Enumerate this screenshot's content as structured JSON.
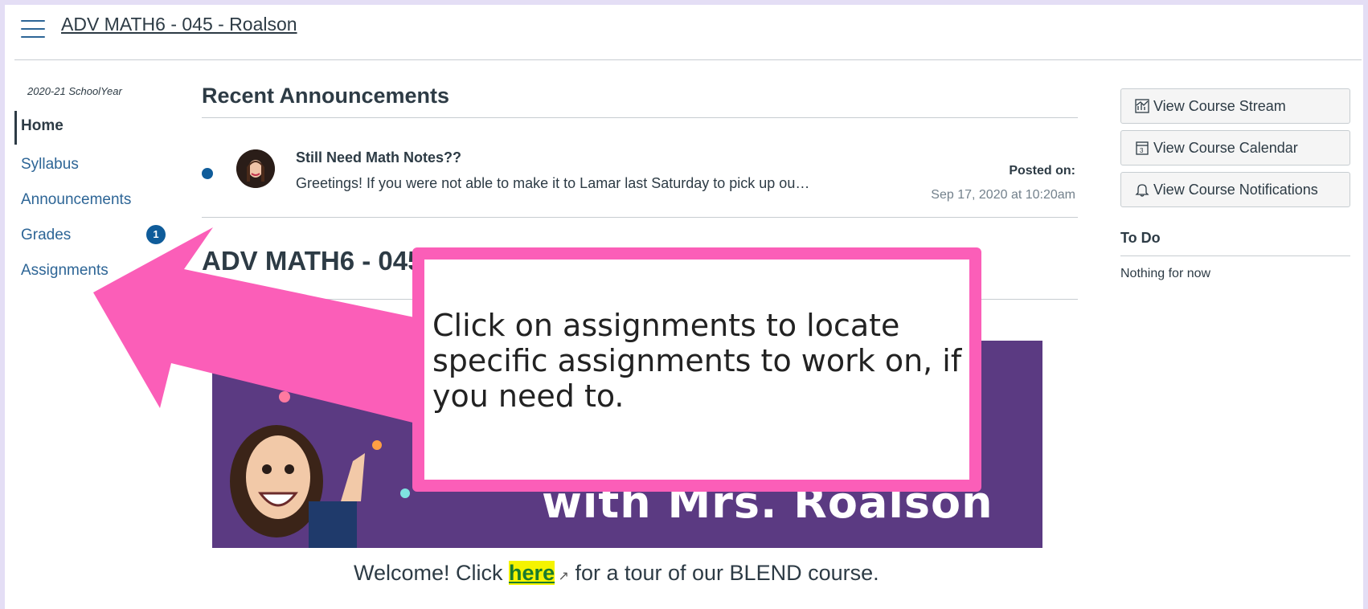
{
  "header": {
    "breadcrumb": "ADV MATH6 - 045 - Roalson"
  },
  "nav": {
    "term": "2020-21 SchoolYear",
    "items": [
      {
        "label": "Home"
      },
      {
        "label": "Syllabus"
      },
      {
        "label": "Announcements"
      },
      {
        "label": "Grades",
        "badge": "1"
      },
      {
        "label": "Assignments"
      }
    ]
  },
  "announcements": {
    "title": "Recent Announcements",
    "post": {
      "title": "Still Need Math Notes??",
      "excerpt": "Greetings! If you were not able to make it to Lamar last Saturday to pick up ou…",
      "posted_label": "Posted on:",
      "posted_date": "Sep 17, 2020 at 10:20am"
    }
  },
  "course": {
    "heading": "ADV MATH6 - 045",
    "banner_text": "with Mrs. Roalson",
    "welcome_before": "Welcome! Click ",
    "welcome_link": "here",
    "welcome_after": " for a tour of our BLEND course."
  },
  "sidebar": {
    "buttons": [
      {
        "label": "View Course Stream",
        "icon": "stream-chart-icon"
      },
      {
        "label": "View Course Calendar",
        "icon": "calendar-icon"
      },
      {
        "label": "View Course Notifications",
        "icon": "bell-icon"
      }
    ],
    "todo_title": "To Do",
    "todo_empty": "Nothing for now"
  },
  "callout": {
    "text": "Click on assignments to locate specific assignments to work on, if you need to."
  },
  "colors": {
    "accent": "#2d6596",
    "badge": "#0f5c9a",
    "overlay": "#fb5eb8",
    "banner": "#5b3a82"
  }
}
